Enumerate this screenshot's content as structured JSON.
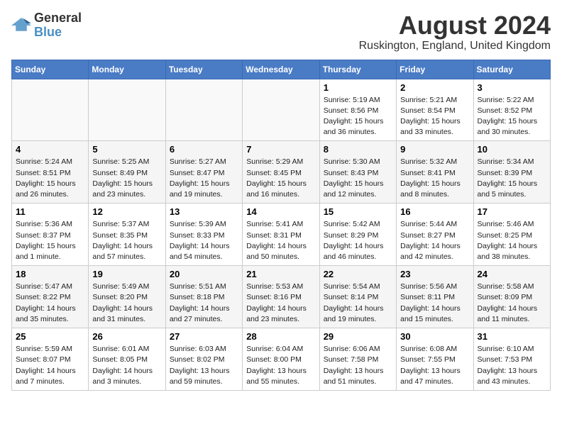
{
  "header": {
    "logo_line1": "General",
    "logo_line2": "Blue",
    "month_year": "August 2024",
    "location": "Ruskington, England, United Kingdom"
  },
  "weekdays": [
    "Sunday",
    "Monday",
    "Tuesday",
    "Wednesday",
    "Thursday",
    "Friday",
    "Saturday"
  ],
  "weeks": [
    [
      {
        "day": "",
        "info": ""
      },
      {
        "day": "",
        "info": ""
      },
      {
        "day": "",
        "info": ""
      },
      {
        "day": "",
        "info": ""
      },
      {
        "day": "1",
        "info": "Sunrise: 5:19 AM\nSunset: 8:56 PM\nDaylight: 15 hours\nand 36 minutes."
      },
      {
        "day": "2",
        "info": "Sunrise: 5:21 AM\nSunset: 8:54 PM\nDaylight: 15 hours\nand 33 minutes."
      },
      {
        "day": "3",
        "info": "Sunrise: 5:22 AM\nSunset: 8:52 PM\nDaylight: 15 hours\nand 30 minutes."
      }
    ],
    [
      {
        "day": "4",
        "info": "Sunrise: 5:24 AM\nSunset: 8:51 PM\nDaylight: 15 hours\nand 26 minutes."
      },
      {
        "day": "5",
        "info": "Sunrise: 5:25 AM\nSunset: 8:49 PM\nDaylight: 15 hours\nand 23 minutes."
      },
      {
        "day": "6",
        "info": "Sunrise: 5:27 AM\nSunset: 8:47 PM\nDaylight: 15 hours\nand 19 minutes."
      },
      {
        "day": "7",
        "info": "Sunrise: 5:29 AM\nSunset: 8:45 PM\nDaylight: 15 hours\nand 16 minutes."
      },
      {
        "day": "8",
        "info": "Sunrise: 5:30 AM\nSunset: 8:43 PM\nDaylight: 15 hours\nand 12 minutes."
      },
      {
        "day": "9",
        "info": "Sunrise: 5:32 AM\nSunset: 8:41 PM\nDaylight: 15 hours\nand 8 minutes."
      },
      {
        "day": "10",
        "info": "Sunrise: 5:34 AM\nSunset: 8:39 PM\nDaylight: 15 hours\nand 5 minutes."
      }
    ],
    [
      {
        "day": "11",
        "info": "Sunrise: 5:36 AM\nSunset: 8:37 PM\nDaylight: 15 hours\nand 1 minute."
      },
      {
        "day": "12",
        "info": "Sunrise: 5:37 AM\nSunset: 8:35 PM\nDaylight: 14 hours\nand 57 minutes."
      },
      {
        "day": "13",
        "info": "Sunrise: 5:39 AM\nSunset: 8:33 PM\nDaylight: 14 hours\nand 54 minutes."
      },
      {
        "day": "14",
        "info": "Sunrise: 5:41 AM\nSunset: 8:31 PM\nDaylight: 14 hours\nand 50 minutes."
      },
      {
        "day": "15",
        "info": "Sunrise: 5:42 AM\nSunset: 8:29 PM\nDaylight: 14 hours\nand 46 minutes."
      },
      {
        "day": "16",
        "info": "Sunrise: 5:44 AM\nSunset: 8:27 PM\nDaylight: 14 hours\nand 42 minutes."
      },
      {
        "day": "17",
        "info": "Sunrise: 5:46 AM\nSunset: 8:25 PM\nDaylight: 14 hours\nand 38 minutes."
      }
    ],
    [
      {
        "day": "18",
        "info": "Sunrise: 5:47 AM\nSunset: 8:22 PM\nDaylight: 14 hours\nand 35 minutes."
      },
      {
        "day": "19",
        "info": "Sunrise: 5:49 AM\nSunset: 8:20 PM\nDaylight: 14 hours\nand 31 minutes."
      },
      {
        "day": "20",
        "info": "Sunrise: 5:51 AM\nSunset: 8:18 PM\nDaylight: 14 hours\nand 27 minutes."
      },
      {
        "day": "21",
        "info": "Sunrise: 5:53 AM\nSunset: 8:16 PM\nDaylight: 14 hours\nand 23 minutes."
      },
      {
        "day": "22",
        "info": "Sunrise: 5:54 AM\nSunset: 8:14 PM\nDaylight: 14 hours\nand 19 minutes."
      },
      {
        "day": "23",
        "info": "Sunrise: 5:56 AM\nSunset: 8:11 PM\nDaylight: 14 hours\nand 15 minutes."
      },
      {
        "day": "24",
        "info": "Sunrise: 5:58 AM\nSunset: 8:09 PM\nDaylight: 14 hours\nand 11 minutes."
      }
    ],
    [
      {
        "day": "25",
        "info": "Sunrise: 5:59 AM\nSunset: 8:07 PM\nDaylight: 14 hours\nand 7 minutes."
      },
      {
        "day": "26",
        "info": "Sunrise: 6:01 AM\nSunset: 8:05 PM\nDaylight: 14 hours\nand 3 minutes."
      },
      {
        "day": "27",
        "info": "Sunrise: 6:03 AM\nSunset: 8:02 PM\nDaylight: 13 hours\nand 59 minutes."
      },
      {
        "day": "28",
        "info": "Sunrise: 6:04 AM\nSunset: 8:00 PM\nDaylight: 13 hours\nand 55 minutes."
      },
      {
        "day": "29",
        "info": "Sunrise: 6:06 AM\nSunset: 7:58 PM\nDaylight: 13 hours\nand 51 minutes."
      },
      {
        "day": "30",
        "info": "Sunrise: 6:08 AM\nSunset: 7:55 PM\nDaylight: 13 hours\nand 47 minutes."
      },
      {
        "day": "31",
        "info": "Sunrise: 6:10 AM\nSunset: 7:53 PM\nDaylight: 13 hours\nand 43 minutes."
      }
    ]
  ]
}
